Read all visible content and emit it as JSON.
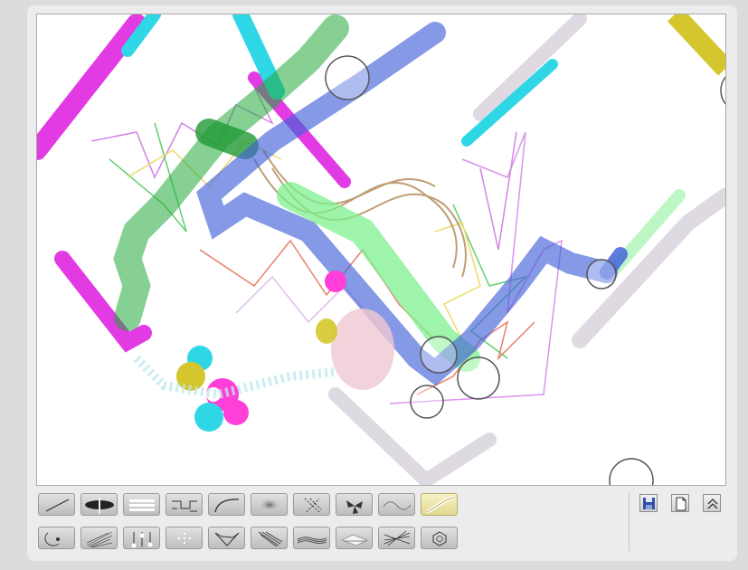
{
  "canvas": {
    "background": "#ffffff",
    "stroke_colors": {
      "magenta": "#e23be3",
      "cyan": "#2fd6e6",
      "yellow": "#d4c62c",
      "green": "#23a93a",
      "light_green": "#7ef08e",
      "blue": "#4463d8",
      "gray": "#d9d4dc",
      "pink": "#f0c8d2"
    }
  },
  "toolbar": {
    "row1": [
      {
        "icon": "line-brush-icon"
      },
      {
        "icon": "ellipse-brush-icon"
      },
      {
        "icon": "parallel-lines-brush-icon"
      },
      {
        "icon": "circuit-brush-icon"
      },
      {
        "icon": "curve-brush-icon"
      },
      {
        "icon": "soft-blob-brush-icon"
      },
      {
        "icon": "cross-hatch-brush-icon"
      },
      {
        "icon": "fan-brush-icon"
      },
      {
        "icon": "wave-brush-icon"
      },
      {
        "icon": "ribbon-brush-icon",
        "selected": true
      }
    ],
    "row2": [
      {
        "icon": "spiral-dot-brush-icon"
      },
      {
        "icon": "sketch-lines-brush-icon"
      },
      {
        "icon": "pin-brush-icon"
      },
      {
        "icon": "dotted-brush-icon"
      },
      {
        "icon": "web-brush-icon"
      },
      {
        "icon": "fur-brush-icon"
      },
      {
        "icon": "multi-line-brush-icon"
      },
      {
        "icon": "shaded-brush-icon"
      },
      {
        "icon": "hatch-lines-brush-icon"
      },
      {
        "icon": "hexagon-brush-icon"
      }
    ],
    "accent_selected": "#e2d98e"
  },
  "system_buttons": [
    {
      "icon": "save-icon"
    },
    {
      "icon": "new-document-icon"
    },
    {
      "icon": "collapse-up-icon"
    }
  ]
}
